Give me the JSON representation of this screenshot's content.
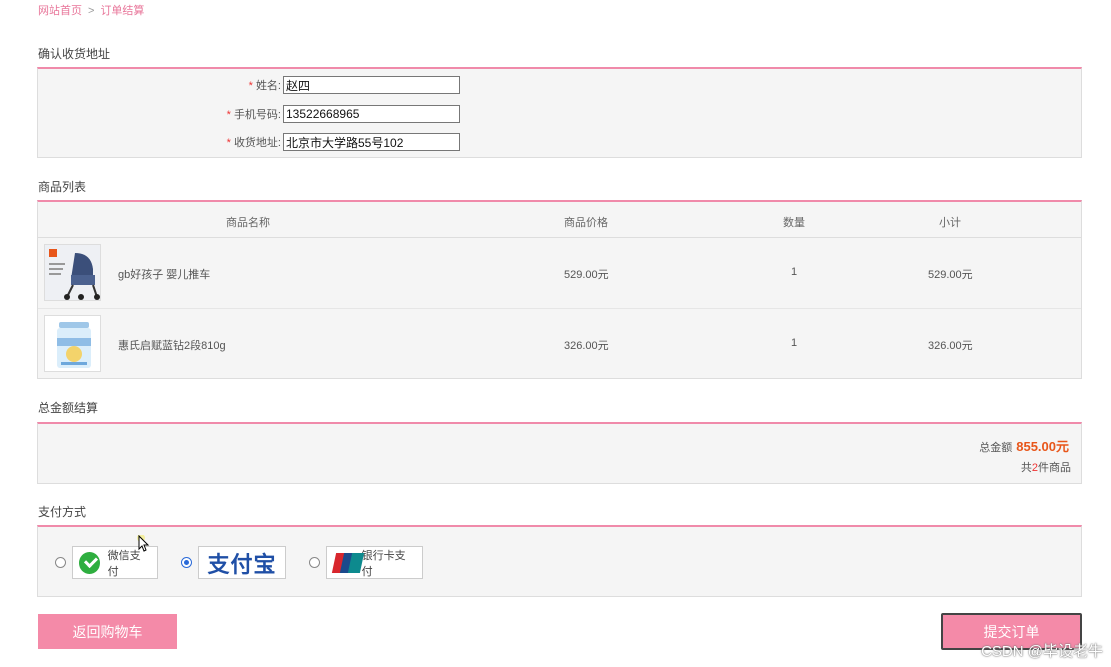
{
  "breadcrumb": {
    "home": "网站首页",
    "separator": ">",
    "current": "订单结算"
  },
  "address": {
    "title": "确认收货地址",
    "fields": [
      {
        "required": "*",
        "label": "姓名:",
        "value": "赵四"
      },
      {
        "required": "*",
        "label": "手机号码:",
        "value": "13522668965"
      },
      {
        "required": "*",
        "label": "收货地址:",
        "value": "北京市大学路55号102"
      }
    ]
  },
  "products": {
    "title": "商品列表",
    "headers": {
      "name": "商品名称",
      "price": "商品价格",
      "qty": "数量",
      "subtotal": "小计"
    },
    "rows": [
      {
        "name": "gb好孩子 婴儿推车",
        "price": "529.00元",
        "qty": "1",
        "subtotal": "529.00元",
        "icon": "stroller-image"
      },
      {
        "name": "惠氏启赋蓝钻2段810g",
        "price": "326.00元",
        "qty": "1",
        "subtotal": "326.00元",
        "icon": "milk-powder-image"
      }
    ]
  },
  "total": {
    "title": "总金额结算",
    "label": "总金额",
    "amount": "855.00元",
    "count_prefix": "共",
    "count": "2",
    "count_suffix": "件商品"
  },
  "payment": {
    "title": "支付方式",
    "options": [
      {
        "label": "微信支付",
        "selected": false,
        "icon": "wechat-icon"
      },
      {
        "label": "支付宝",
        "selected": true,
        "icon": "alipay-icon"
      },
      {
        "label": "银行卡支付",
        "selected": false,
        "icon": "unionpay-icon"
      }
    ]
  },
  "buttons": {
    "back": "返回购物车",
    "submit": "提交订单"
  },
  "watermark": "CSDN @毕设老牛",
  "colors": {
    "accent": "#f48aa8",
    "price": "#e8561a",
    "selected": "#2a6ad8"
  }
}
